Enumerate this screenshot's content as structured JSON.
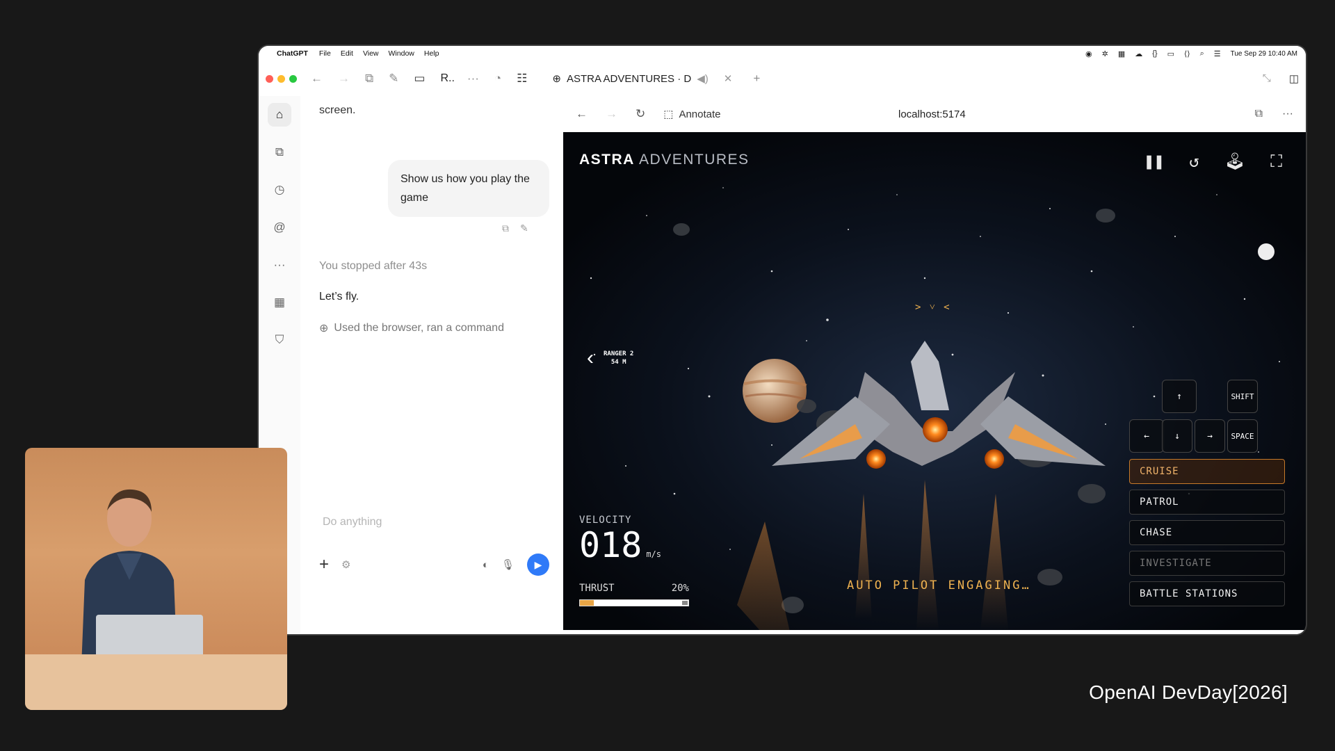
{
  "menubar": {
    "app": "ChatGPT",
    "items": [
      "File",
      "Edit",
      "View",
      "Window",
      "Help"
    ],
    "datetime": "Tue Sep 29  10:40 AM"
  },
  "tabbar": {
    "folder_label": "R..",
    "tab_title": "ASTRA ADVENTURES · D",
    "traffic_colors": [
      "#ff5f57",
      "#febc2e",
      "#28c840"
    ]
  },
  "chat": {
    "prev_text": "screen.",
    "user_message": "Show us how you play the game",
    "stopped": "You stopped after 43s",
    "reply": "Let’s fly.",
    "tool_use": "Used the browser, ran a command",
    "input_placeholder": "Do anything"
  },
  "browser": {
    "annotate": "Annotate",
    "url": "localhost:5174"
  },
  "game": {
    "title_bold": "ASTRA",
    "title_rest": " ADVENTURES",
    "target_name": "RANGER 2",
    "target_dist": "54 M",
    "velocity_label": "VELOCITY",
    "velocity_value": "018",
    "velocity_unit": "m/s",
    "thrust_label": "THRUST",
    "thrust_pct": "20%",
    "thrust_fraction": 0.13,
    "status": "AUTO PILOT ENGAGING…",
    "keys": {
      "up": "↑",
      "down": "↓",
      "left": "←",
      "right": "→",
      "shift": "SHIFT",
      "space": "SPACE"
    },
    "modes": [
      "CRUISE",
      "PATROL",
      "CHASE",
      "INVESTIGATE",
      "BATTLE STATIONS"
    ],
    "accent": "#f0b350"
  },
  "footer": {
    "brand": "OpenAI DevDay[2026]"
  }
}
